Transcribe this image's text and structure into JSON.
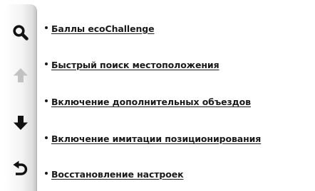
{
  "sidebar": {
    "buttons": [
      {
        "icon": "search-icon",
        "enabled": true
      },
      {
        "icon": "arrow-up-icon",
        "enabled": false
      },
      {
        "icon": "arrow-down-icon",
        "enabled": true
      },
      {
        "icon": "back-icon",
        "enabled": true
      }
    ]
  },
  "colors": {
    "text": "#1a1a1a",
    "icon": "#111111",
    "icon_disabled": "#c2c2c2",
    "background": "#ffffff"
  },
  "list": {
    "items": [
      {
        "label": "Баллы ecoChallenge"
      },
      {
        "label": "Быстрый поиск местоположения"
      },
      {
        "label": "Включение дополнительных объездов"
      },
      {
        "label": "Включение имитации позиционирования"
      },
      {
        "label": "Восстановление настроек"
      }
    ]
  }
}
